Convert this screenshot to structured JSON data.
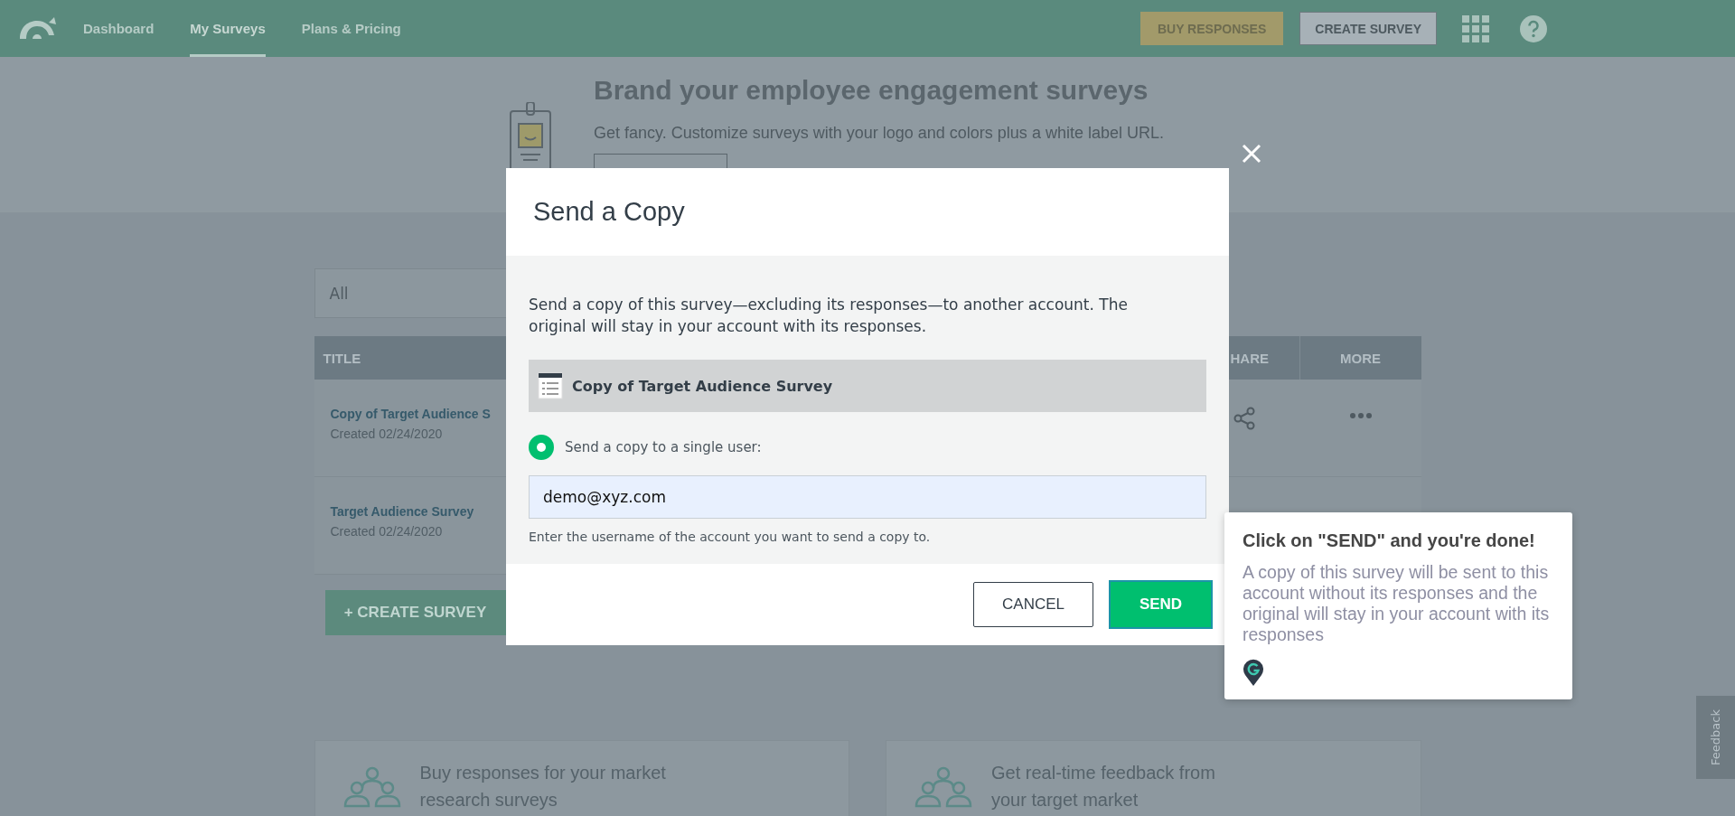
{
  "nav": {
    "items": [
      {
        "label": "Dashboard",
        "selected": false
      },
      {
        "label": "My Surveys",
        "selected": true
      },
      {
        "label": "Plans & Pricing",
        "selected": false
      }
    ],
    "buy_button": "BUY RESPONSES",
    "create_button": "CREATE SURVEY"
  },
  "banner": {
    "title": "Brand your employee engagement surveys",
    "subtitle": "Get fancy. Customize surveys with your logo and colors plus a white label URL."
  },
  "filter": {
    "value": "All"
  },
  "table": {
    "columns": [
      "TITLE",
      "HARE",
      "MORE"
    ],
    "rows": [
      {
        "title": "Copy of Target Audience S",
        "created": "Created 02/24/2020",
        "actions": true
      },
      {
        "title": "Target Audience Survey",
        "created": "Created 02/24/2020",
        "actions": false
      }
    ]
  },
  "create_button": "+ CREATE SURVEY",
  "promo_cards": [
    {
      "text": "Buy responses for your market research surveys"
    },
    {
      "text": "Get real-time feedback from your target market"
    }
  ],
  "feedback_tab": "Feedback",
  "modal": {
    "title": "Send a Copy",
    "description": "Send a copy of this survey—excluding its responses—to another account. The original will stay in your account with its responses.",
    "survey_name": "Copy of Target Audience Survey",
    "radio": {
      "label": "Send a copy to a single user:",
      "selected": true
    },
    "email": "demo@xyz.com",
    "hint": "Enter the username of the account you want to send a copy to.",
    "cancel": "CANCEL",
    "send": "SEND"
  },
  "tooltip": {
    "title": "Click on \"SEND\" and you're done!",
    "body": "A copy of this survey will be sent to this account without its responses and the original will stay in your account with its responses"
  }
}
